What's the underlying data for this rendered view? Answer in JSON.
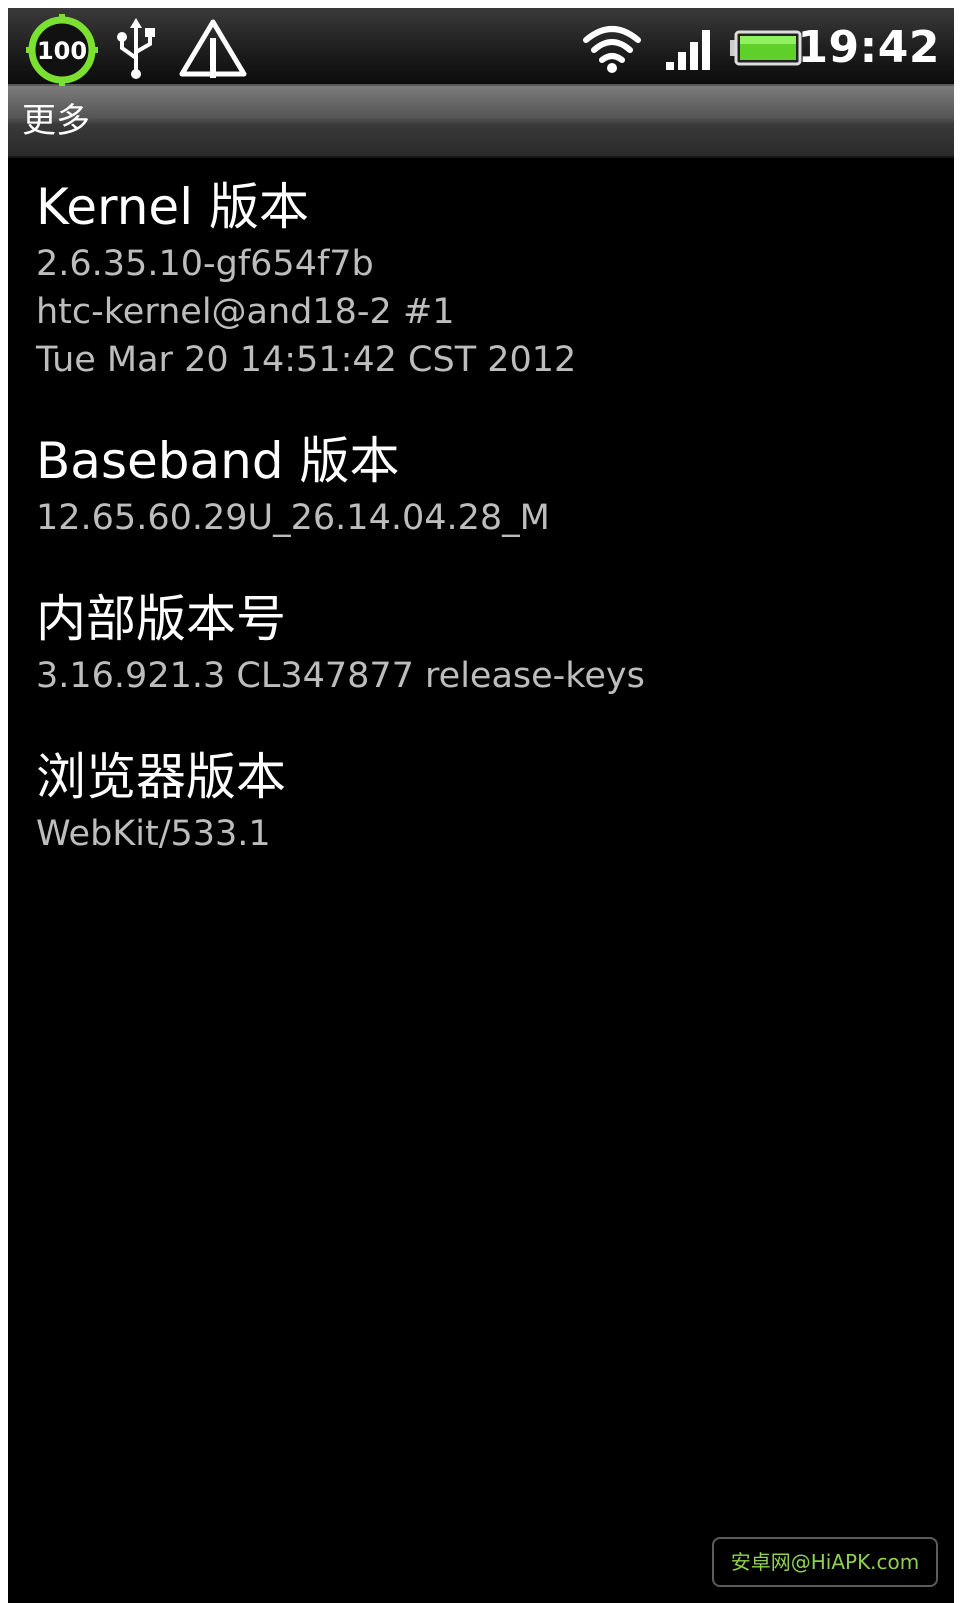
{
  "status_bar": {
    "battery_badge_value": "100",
    "time": "19:42",
    "icons": [
      "battery-badge-icon",
      "usb-icon",
      "alert-icon",
      "wifi-icon",
      "signal-icon",
      "battery-icon"
    ],
    "colors": {
      "badge_ring": "#7be032",
      "battery_fill": "#5fd02a"
    }
  },
  "title_bar": {
    "title": "更多"
  },
  "items": [
    {
      "title": "Kernel 版本",
      "summary": [
        "2.6.35.10-gf654f7b",
        "htc-kernel@and18-2 #1",
        "Tue Mar 20 14:51:42 CST 2012"
      ]
    },
    {
      "title": "Baseband 版本",
      "summary": [
        "12.65.60.29U_26.14.04.28_M"
      ]
    },
    {
      "title": "内部版本号",
      "summary": [
        "3.16.921.3 CL347877 release-keys"
      ]
    },
    {
      "title": "浏览器版本",
      "summary": [
        "WebKit/533.1"
      ]
    }
  ],
  "watermark": {
    "text": "安卓网@HiAPK.com"
  }
}
